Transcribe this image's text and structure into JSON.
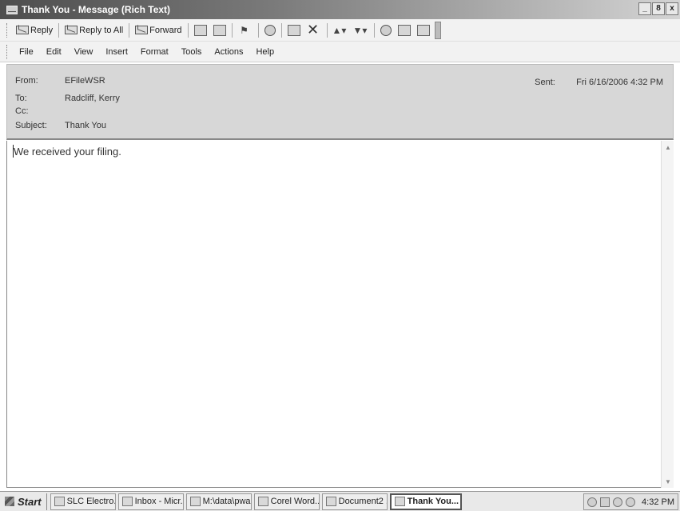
{
  "window": {
    "title": "Thank You - Message (Rich Text)",
    "controls": [
      "_",
      "8",
      "x"
    ]
  },
  "toolbar": {
    "reply_label": "Reply",
    "reply_all_label": "Reply to All",
    "forward_label": "Forward",
    "icons": [
      "print-icon",
      "save-icon",
      "flag-icon",
      "move-icon",
      "categorize-icon",
      "delete-icon",
      "previous-icon",
      "next-icon",
      "help-icon",
      "options-icon",
      "address-book-icon",
      "overflow-icon"
    ]
  },
  "menu": {
    "file": "File",
    "edit": "Edit",
    "view": "View",
    "insert": "Insert",
    "format": "Format",
    "tools": "Tools",
    "actions": "Actions",
    "help": "Help"
  },
  "header": {
    "from_label": "From:",
    "from_value": "EFileWSR",
    "to_label": "To:",
    "to_value": "Radcliff, Kerry",
    "cc_label": "Cc:",
    "cc_value": "",
    "subject_label": "Subject:",
    "subject_value": "Thank You",
    "sent_label": "Sent:",
    "sent_value": "Fri 6/16/2006 4:32 PM"
  },
  "body": {
    "text": "We received your filing."
  },
  "taskbar": {
    "start_label": "Start",
    "tasks": [
      {
        "label": "SLC Electro..."
      },
      {
        "label": "Inbox - Micr..."
      },
      {
        "label": "M:\\data\\pwa"
      },
      {
        "label": "Corel Word..."
      },
      {
        "label": "Document2 ..."
      },
      {
        "label": "Thank You..."
      }
    ],
    "clock": "4:32 PM"
  }
}
